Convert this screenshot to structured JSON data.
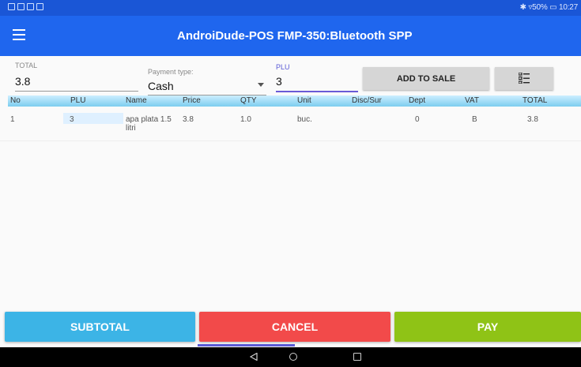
{
  "status_bar": {
    "right_text": "✱ ▿50% ▭ 10:27"
  },
  "app_bar": {
    "title": "AndroiDude-POS   FMP-350:Bluetooth SPP",
    "menu_icon": "hamburger-menu-icon"
  },
  "form": {
    "total_label": "TOTAL",
    "total_value": "3.8",
    "payment_label": "Payment type:",
    "payment_value": "Cash",
    "plu_label": "PLU",
    "plu_value": "3",
    "add_button": "ADD TO SALE",
    "list_icon": "list-icon"
  },
  "table": {
    "headers": [
      "No",
      "PLU",
      "Name",
      "Price",
      "QTY",
      "Unit",
      "Disc/Sur",
      "Dept",
      "VAT",
      "TOTAL"
    ],
    "rows": [
      [
        "1",
        "3",
        "apa plata 1.5 litri",
        "3.8",
        "1.0",
        "buc.",
        "",
        "0",
        "B",
        "3.8"
      ]
    ]
  },
  "actions": {
    "subtotal": "SUBTOTAL",
    "cancel": "CANCEL",
    "pay": "PAY"
  },
  "colors": {
    "app_bar": "#1f66ee",
    "subtotal": "#3cb4e6",
    "cancel": "#f24a4a",
    "pay": "#8fc316"
  }
}
